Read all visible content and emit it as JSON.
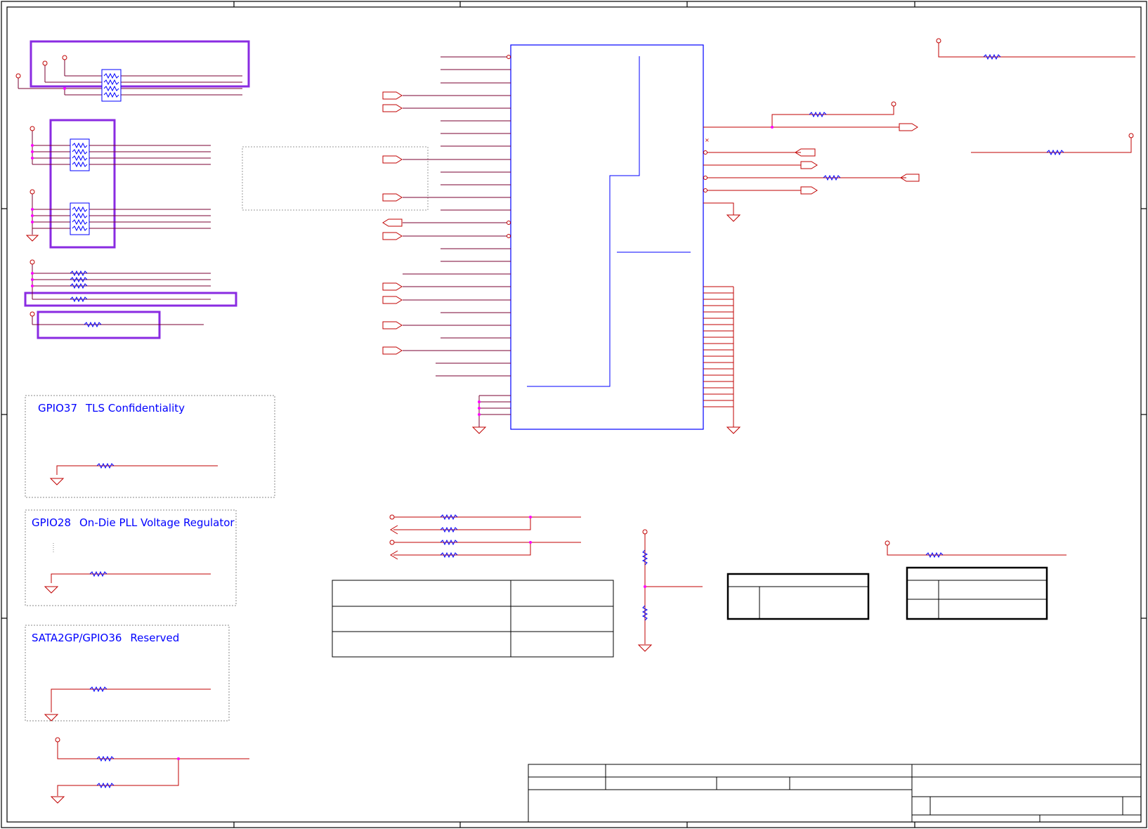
{
  "notes": {
    "gpio37": {
      "pin": "GPIO37",
      "desc": "TLS Confidentiality"
    },
    "gpio28": {
      "pin": "GPIO28",
      "desc": "On-Die PLL Voltage Regulator"
    },
    "sata2gp": {
      "pin": "SATA2GP/GPIO36",
      "desc": "Reserved"
    }
  },
  "colors": {
    "border": "#000000",
    "wire": "#c00000",
    "wire_dark": "#7a0030",
    "component": "#0000ff",
    "highlight": "#8a2be2",
    "junction": "#ff00ff",
    "dashed_box": "#888888"
  }
}
